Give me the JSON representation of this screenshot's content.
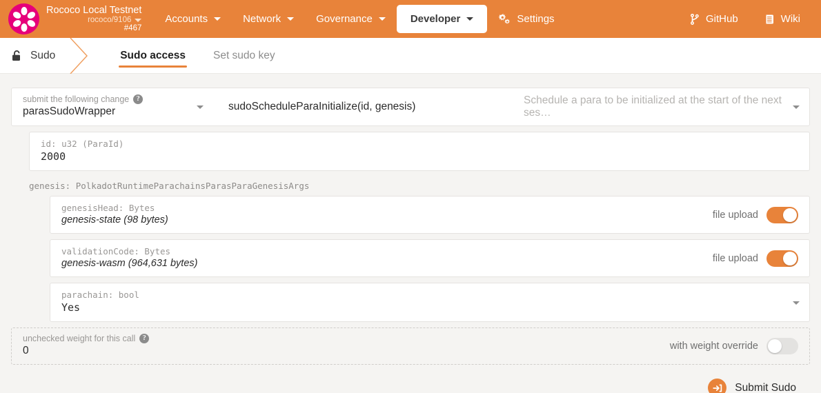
{
  "header": {
    "logo_icon": "polkadot-logo-icon",
    "chain_name": "Rococo Local Testnet",
    "chain_endpoint": "rococo/9106",
    "chain_block": "#467",
    "nav": [
      {
        "label": "Accounts",
        "has_caret": true,
        "active": false
      },
      {
        "label": "Network",
        "has_caret": true,
        "active": false
      },
      {
        "label": "Governance",
        "has_caret": true,
        "active": false
      },
      {
        "label": "Developer",
        "has_caret": true,
        "active": true
      },
      {
        "label": "Settings",
        "has_caret": false,
        "active": false,
        "icon": "gears-icon"
      }
    ],
    "right_links": [
      {
        "label": "GitHub",
        "icon": "code-branch-icon"
      },
      {
        "label": "Wiki",
        "icon": "book-icon"
      }
    ],
    "bg_color": "#e8833a",
    "logo_color": "#e6007a"
  },
  "breadcrumb": {
    "icon": "unlock-icon",
    "label": "Sudo"
  },
  "tabs": [
    {
      "label": "Sudo access",
      "active": true
    },
    {
      "label": "Set sudo key",
      "active": false
    }
  ],
  "form": {
    "submit_change": {
      "label": "submit the following change",
      "help_icon": "help-circle-icon",
      "module_value": "parasSudoWrapper",
      "method_value": "sudoScheduleParaInitialize(id, genesis)",
      "description_placeholder": "Schedule a para to be initialized at the start of the next ses…"
    },
    "fields": [
      {
        "name": "id",
        "label": "id: u32 (ParaId)",
        "value": "2000",
        "style": "mono"
      }
    ],
    "genesis_section_label": "genesis: PolkadotRuntimeParachainsParasParaGenesisArgs",
    "genesis_fields": [
      {
        "name": "genesisHead",
        "label": "genesisHead: Bytes",
        "value": "genesis-state (98 bytes)",
        "toggle_label": "file upload",
        "toggle_on": true
      },
      {
        "name": "validationCode",
        "label": "validationCode: Bytes",
        "value": "genesis-wasm (964,631 bytes)",
        "toggle_label": "file upload",
        "toggle_on": true
      },
      {
        "name": "parachain",
        "label": "parachain: bool",
        "value": "Yes",
        "is_select": true
      }
    ],
    "weight": {
      "label": "unchecked weight for this call",
      "help_icon": "help-circle-icon",
      "value": "0",
      "toggle_label": "with weight override",
      "toggle_on": false
    },
    "submit_button": {
      "label": "Submit Sudo",
      "icon": "sign-in-icon"
    }
  },
  "colors": {
    "accent": "#e8833a",
    "brand_pink": "#e6007a",
    "page_bg": "#f5f4f2",
    "panel_bg": "#ffffff"
  }
}
